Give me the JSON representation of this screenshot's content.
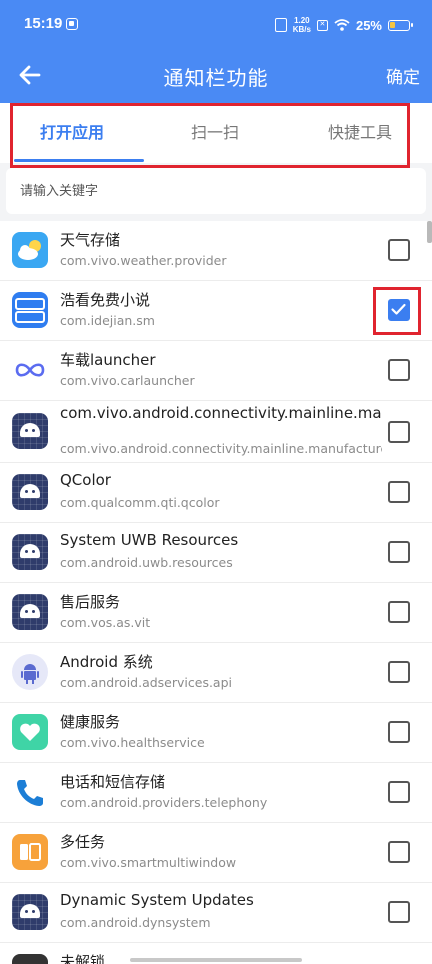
{
  "status_bar": {
    "time": "15:19",
    "net_speed_value": "1.20",
    "net_speed_unit": "KB/s",
    "battery": "25%"
  },
  "header": {
    "title": "通知栏功能",
    "confirm_label": "确定",
    "back_icon": "back-arrow-icon",
    "background_color": "#4a8af4"
  },
  "tabs": [
    {
      "label": "打开应用",
      "active": true
    },
    {
      "label": "扫一扫",
      "active": false
    },
    {
      "label": "快捷工具",
      "active": false
    }
  ],
  "search": {
    "placeholder": "请输入关键字",
    "value": ""
  },
  "apps": [
    {
      "name": "天气存储",
      "package": "com.vivo.weather.provider",
      "checked": false,
      "icon": "weather-icon"
    },
    {
      "name": "浩看免费小说",
      "package": "com.idejian.sm",
      "checked": true,
      "icon": "novel-icon"
    },
    {
      "name": "车载launcher",
      "package": "com.vivo.carlauncher",
      "checked": false,
      "icon": "infinity-icon"
    },
    {
      "name": "com.vivo.android.connectivity.mainline.manufacturer.resources.overlay",
      "package": "com.vivo.android.connectivity.mainline.manufacturer",
      "checked": false,
      "icon": "android-icon"
    },
    {
      "name": "QColor",
      "package": "com.qualcomm.qti.qcolor",
      "checked": false,
      "icon": "android-icon"
    },
    {
      "name": "System UWB Resources",
      "package": "com.android.uwb.resources",
      "checked": false,
      "icon": "android-icon"
    },
    {
      "name": "售后服务",
      "package": "com.vos.as.vit",
      "checked": false,
      "icon": "android-icon"
    },
    {
      "name": "Android 系统",
      "package": "com.android.adservices.api",
      "checked": false,
      "icon": "android-round-icon"
    },
    {
      "name": "健康服务",
      "package": "com.vivo.healthservice",
      "checked": false,
      "icon": "health-icon"
    },
    {
      "name": "电话和短信存储",
      "package": "com.android.providers.telephony",
      "checked": false,
      "icon": "phone-icon"
    },
    {
      "name": "多任务",
      "package": "com.vivo.smartmultiwindow",
      "checked": false,
      "icon": "multiwindow-icon"
    },
    {
      "name": "Dynamic System Updates",
      "package": "com.android.dynsystem",
      "checked": false,
      "icon": "android-icon"
    },
    {
      "name": "未解锁",
      "package": "",
      "checked": false,
      "icon": "partial-icon"
    }
  ],
  "colors": {
    "accent": "#3b7ef0",
    "highlight_box": "#e0242f"
  }
}
